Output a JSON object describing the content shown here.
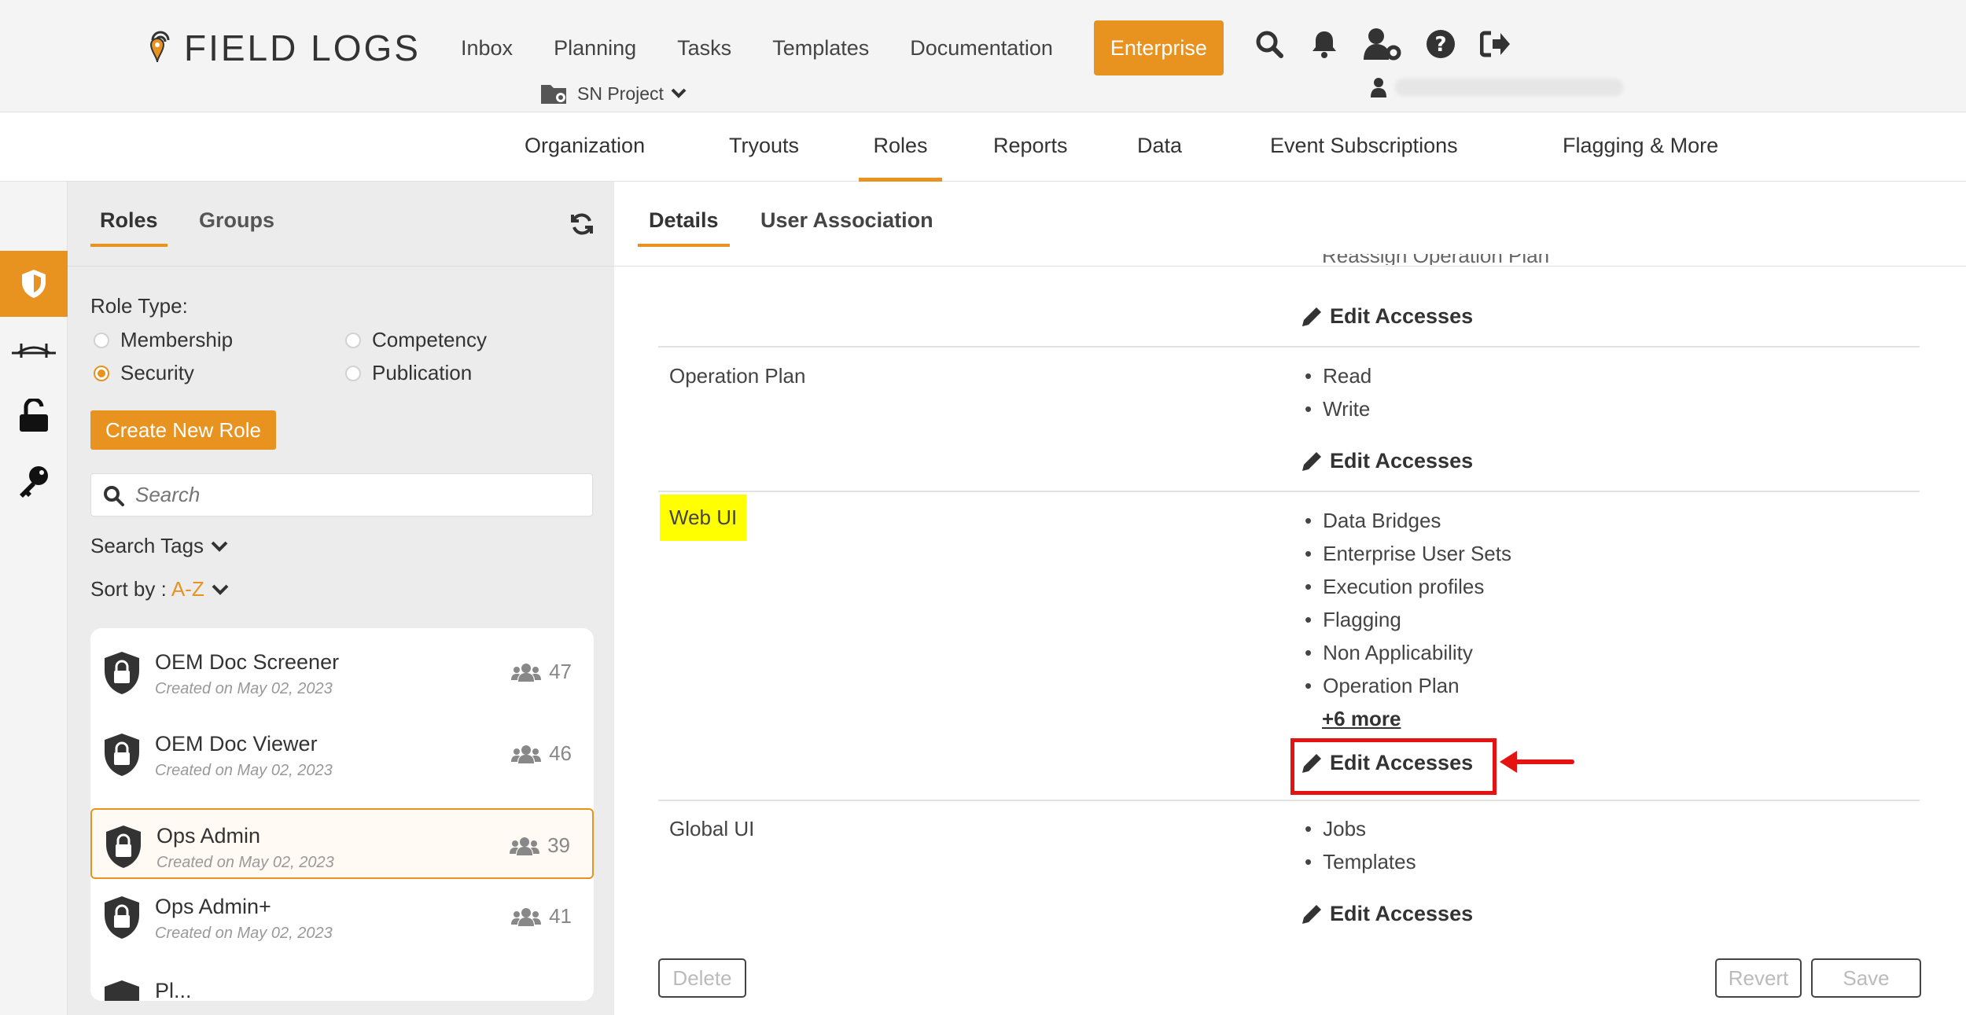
{
  "brand": {
    "name": "FIELD LOGS",
    "accent": "#e8921f"
  },
  "topnav": {
    "items": [
      "Inbox",
      "Planning",
      "Tasks",
      "Templates",
      "Documentation"
    ],
    "active": "Enterprise"
  },
  "project": {
    "name": "SN Project"
  },
  "icons": {
    "search": "search-icon",
    "bell": "bell-icon",
    "user_settings": "user-settings-icon",
    "help": "help-icon",
    "logout": "logout-icon",
    "user": "user-icon"
  },
  "subnav": {
    "items": [
      "Organization",
      "Tryouts",
      "Roles",
      "Reports",
      "Data",
      "Event Subscriptions",
      "Flagging & More"
    ],
    "active": "Roles"
  },
  "left_panel": {
    "tabs": [
      "Roles",
      "Groups"
    ],
    "active_tab": "Roles",
    "role_type_label": "Role Type:",
    "role_types": [
      "Membership",
      "Competency",
      "Security",
      "Publication"
    ],
    "selected_role_type": "Security",
    "create_button": "Create New Role",
    "search_placeholder": "Search",
    "search_tags_label": "Search Tags",
    "sort_label": "Sort by :",
    "sort_value": "A-Z",
    "roles": [
      {
        "name": "OEM Doc Screener",
        "created": "Created on May 02, 2023",
        "count": "47"
      },
      {
        "name": "OEM Doc Viewer",
        "created": "Created on May 02, 2023",
        "count": "46"
      },
      {
        "name": "Ops Admin",
        "created": "Created on May 02, 2023",
        "count": "39",
        "selected": true
      },
      {
        "name": "Ops Admin+",
        "created": "Created on May 02, 2023",
        "count": "41"
      },
      {
        "name": "Pl...",
        "created": "",
        "count": ""
      }
    ]
  },
  "content": {
    "tabs": [
      "Details",
      "User Association"
    ],
    "active_tab": "Details",
    "truncated_item": "Reassign Operation Plan",
    "edit_label": "Edit Accesses",
    "sections": [
      {
        "label": "Operation Plan",
        "accesses": [
          "Read",
          "Write"
        ]
      },
      {
        "label": "Web UI",
        "accesses": [
          "Data Bridges",
          "Enterprise User Sets",
          "Execution profiles",
          "Flagging",
          "Non Applicability",
          "Operation Plan"
        ],
        "more": "+6 more"
      },
      {
        "label": "Global UI",
        "accesses": [
          "Jobs",
          "Templates"
        ]
      }
    ],
    "footer": {
      "delete": "Delete",
      "revert": "Revert",
      "save": "Save"
    }
  }
}
